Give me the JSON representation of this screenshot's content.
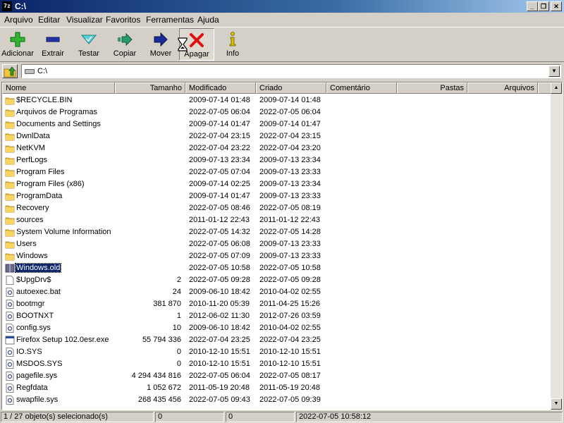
{
  "window": {
    "title": "C:\\",
    "icon_text": "7z"
  },
  "menu": [
    "Arquivo",
    "Editar",
    "Visualizar",
    "Favoritos",
    "Ferramentas",
    "Ajuda"
  ],
  "toolbar": {
    "add": "Adicionar",
    "extract": "Extrair",
    "test": "Testar",
    "copy": "Copiar",
    "move": "Mover",
    "delete": "Apagar",
    "info": "Info"
  },
  "address": {
    "path": "C:\\"
  },
  "columns": {
    "name": "Nome",
    "size": "Tamanho",
    "modified": "Modificado",
    "created": "Criado",
    "comment": "Comentário",
    "folders": "Pastas",
    "files": "Arquivos"
  },
  "files": [
    {
      "name": "$RECYCLE.BIN",
      "size": "",
      "modified": "2009-07-14 01:48",
      "created": "2009-07-14 01:48",
      "type": "folder"
    },
    {
      "name": "Arquivos de Programas",
      "size": "",
      "modified": "2022-07-05 06:04",
      "created": "2022-07-05 06:04",
      "type": "folder"
    },
    {
      "name": "Documents and Settings",
      "size": "",
      "modified": "2009-07-14 01:47",
      "created": "2009-07-14 01:47",
      "type": "folder"
    },
    {
      "name": "DwnlData",
      "size": "",
      "modified": "2022-07-04 23:15",
      "created": "2022-07-04 23:15",
      "type": "folder"
    },
    {
      "name": "NetKVM",
      "size": "",
      "modified": "2022-07-04 23:22",
      "created": "2022-07-04 23:20",
      "type": "folder"
    },
    {
      "name": "PerfLogs",
      "size": "",
      "modified": "2009-07-13 23:34",
      "created": "2009-07-13 23:34",
      "type": "folder"
    },
    {
      "name": "Program Files",
      "size": "",
      "modified": "2022-07-05 07:04",
      "created": "2009-07-13 23:33",
      "type": "folder"
    },
    {
      "name": "Program Files (x86)",
      "size": "",
      "modified": "2009-07-14 02:25",
      "created": "2009-07-13 23:34",
      "type": "folder"
    },
    {
      "name": "ProgramData",
      "size": "",
      "modified": "2009-07-14 01:47",
      "created": "2009-07-13 23:33",
      "type": "folder"
    },
    {
      "name": "Recovery",
      "size": "",
      "modified": "2022-07-05 08:46",
      "created": "2022-07-05 08:19",
      "type": "folder"
    },
    {
      "name": "sources",
      "size": "",
      "modified": "2011-01-12 22:43",
      "created": "2011-01-12 22:43",
      "type": "folder"
    },
    {
      "name": "System Volume Information",
      "size": "",
      "modified": "2022-07-05 14:32",
      "created": "2022-07-05 14:28",
      "type": "folder"
    },
    {
      "name": "Users",
      "size": "",
      "modified": "2022-07-05 06:08",
      "created": "2009-07-13 23:33",
      "type": "folder"
    },
    {
      "name": "Windows",
      "size": "",
      "modified": "2022-07-05 07:09",
      "created": "2009-07-13 23:33",
      "type": "folder"
    },
    {
      "name": "Windows.old",
      "size": "",
      "modified": "2022-07-05 10:58",
      "created": "2022-07-05 10:58",
      "type": "archive",
      "selected": true
    },
    {
      "name": "$UpgDrv$",
      "size": "2",
      "modified": "2022-07-05 09:28",
      "created": "2022-07-05 09:28",
      "type": "file"
    },
    {
      "name": "autoexec.bat",
      "size": "24",
      "modified": "2009-06-10 18:42",
      "created": "2010-04-02 02:55",
      "type": "sys"
    },
    {
      "name": "bootmgr",
      "size": "381 870",
      "modified": "2010-11-20 05:39",
      "created": "2011-04-25 15:26",
      "type": "sys"
    },
    {
      "name": "BOOTNXT",
      "size": "1",
      "modified": "2012-06-02 11:30",
      "created": "2012-07-26 03:59",
      "type": "sys"
    },
    {
      "name": "config.sys",
      "size": "10",
      "modified": "2009-06-10 18:42",
      "created": "2010-04-02 02:55",
      "type": "sys"
    },
    {
      "name": "Firefox Setup 102.0esr.exe",
      "size": "55 794 336",
      "modified": "2022-07-04 23:25",
      "created": "2022-07-04 23:25",
      "type": "exe"
    },
    {
      "name": "IO.SYS",
      "size": "0",
      "modified": "2010-12-10 15:51",
      "created": "2010-12-10 15:51",
      "type": "sys"
    },
    {
      "name": "MSDOS.SYS",
      "size": "0",
      "modified": "2010-12-10 15:51",
      "created": "2010-12-10 15:51",
      "type": "sys"
    },
    {
      "name": "pagefile.sys",
      "size": "4 294 434 816",
      "modified": "2022-07-05 06:04",
      "created": "2022-07-05 08:17",
      "type": "sys"
    },
    {
      "name": "Regfdata",
      "size": "1 052 672",
      "modified": "2011-05-19 20:48",
      "created": "2011-05-19 20:48",
      "type": "sys"
    },
    {
      "name": "swapfile.sys",
      "size": "268 435 456",
      "modified": "2022-07-05 09:43",
      "created": "2022-07-05 09:39",
      "type": "sys"
    }
  ],
  "status": {
    "selection": "1 / 27 objeto(s) selecionado(s)",
    "size1": "0",
    "size2": "0",
    "datetime": "2022-07-05 10:58:12"
  },
  "colors": {
    "title_start": "#0a246a",
    "title_end": "#a6caf0",
    "selection": "#0a246a",
    "folder": "#f5c542"
  }
}
